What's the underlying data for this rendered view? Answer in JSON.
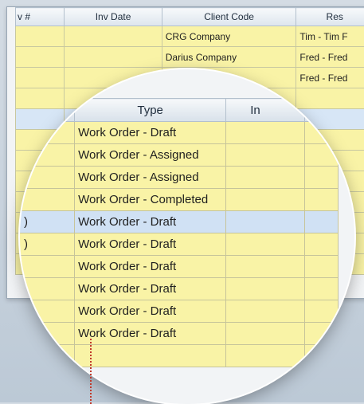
{
  "background_grid": {
    "columns": [
      "v #",
      "Inv Date",
      "Client Code",
      "Res"
    ],
    "rows": [
      {
        "code": "CRG Company",
        "resource": "Tim - Tim F"
      },
      {
        "code": "Darius Company",
        "resource": "Fred - Fred"
      },
      {
        "code": "",
        "resource": "Fred - Fred"
      },
      {
        "code": "",
        "resource": ""
      },
      {
        "code": "",
        "resource": "",
        "selected": true
      },
      {
        "code": "",
        "resource": ""
      },
      {
        "code": "",
        "resource": ""
      },
      {
        "code": "",
        "resource": "ed"
      },
      {
        "code": "",
        "resource": ""
      },
      {
        "code": "",
        "resource": ""
      },
      {
        "code": "",
        "resource": ""
      },
      {
        "code": "",
        "resource": ""
      }
    ]
  },
  "magnifier": {
    "columns": [
      "",
      "Type",
      "In",
      ""
    ],
    "rows": [
      {
        "first": "",
        "type": "Work Order - Draft",
        "inv": ""
      },
      {
        "first": "",
        "type": "Work Order - Assigned",
        "inv": ""
      },
      {
        "first": "",
        "type": "Work Order - Assigned",
        "inv": ""
      },
      {
        "first": "",
        "type": "Work Order - Completed",
        "inv": ""
      },
      {
        "first": ")",
        "type": "Work Order - Draft",
        "inv": "",
        "selected": true
      },
      {
        "first": ")",
        "type": "Work Order - Draft",
        "inv": ""
      },
      {
        "first": "",
        "type": "Work Order - Draft",
        "inv": ""
      },
      {
        "first": "",
        "type": "Work Order - Draft",
        "inv": ""
      },
      {
        "first": "",
        "type": "Work Order - Draft",
        "inv": ""
      },
      {
        "first": "",
        "type": "Work Order - Draft",
        "inv": ""
      },
      {
        "first": "",
        "type": "",
        "inv": ""
      }
    ]
  },
  "colors": {
    "row_yellow": "#f9f3a6",
    "row_selected": "#d0e1f4",
    "pointer": "#c0392b"
  }
}
